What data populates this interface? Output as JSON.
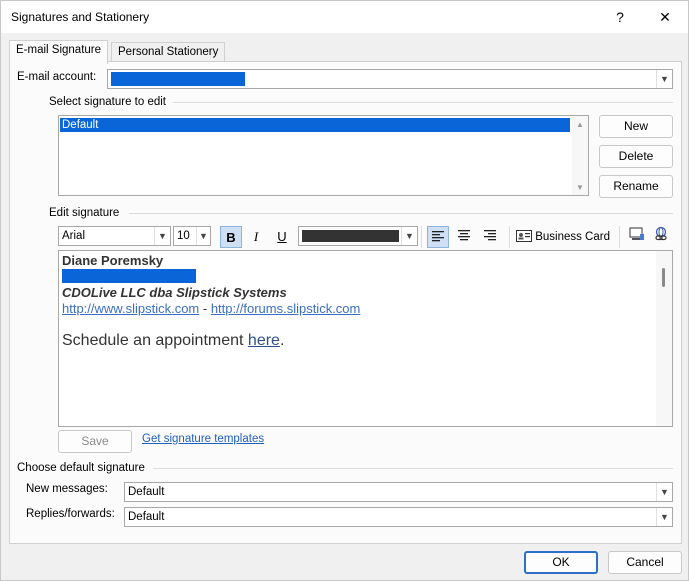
{
  "window": {
    "title": "Signatures and Stationery",
    "help": "?",
    "close": "✕"
  },
  "tabs": [
    {
      "label": "E-mail Signature",
      "active": true
    },
    {
      "label": "Personal Stationery",
      "active": false
    }
  ],
  "email_account": {
    "label": "E-mail account:",
    "value": ""
  },
  "select_signature": {
    "label": "Select signature to edit",
    "items": [
      "Default"
    ],
    "selected": "Default",
    "buttons": {
      "new": "New",
      "delete": "Delete",
      "rename": "Rename"
    }
  },
  "edit_signature": {
    "label": "Edit signature",
    "font": "Arial",
    "size": "10",
    "bold": "B",
    "italic": "I",
    "underline": "U",
    "business_card": "Business Card",
    "content": {
      "name": "Diane Poremsky",
      "company": "CDOLive LLC dba Slipstick Systems",
      "link1": "http://www.slipstick.com",
      "link_sep": " - ",
      "link2": "http://forums.slipstick.com",
      "schedule_text": "Schedule an appointment ",
      "schedule_link": "here",
      "schedule_end": "."
    },
    "save": "Save",
    "templates_link": "Get signature templates"
  },
  "default_signature": {
    "label": "Choose default signature",
    "new_messages_label": "New messages:",
    "new_messages_value": "Default",
    "replies_label": "Replies/forwards:",
    "replies_value": "Default"
  },
  "footer": {
    "ok": "OK",
    "cancel": "Cancel"
  },
  "colors": {
    "accent": "#0a66d8",
    "link": "#3b6fc0",
    "font_color": "#333333"
  }
}
